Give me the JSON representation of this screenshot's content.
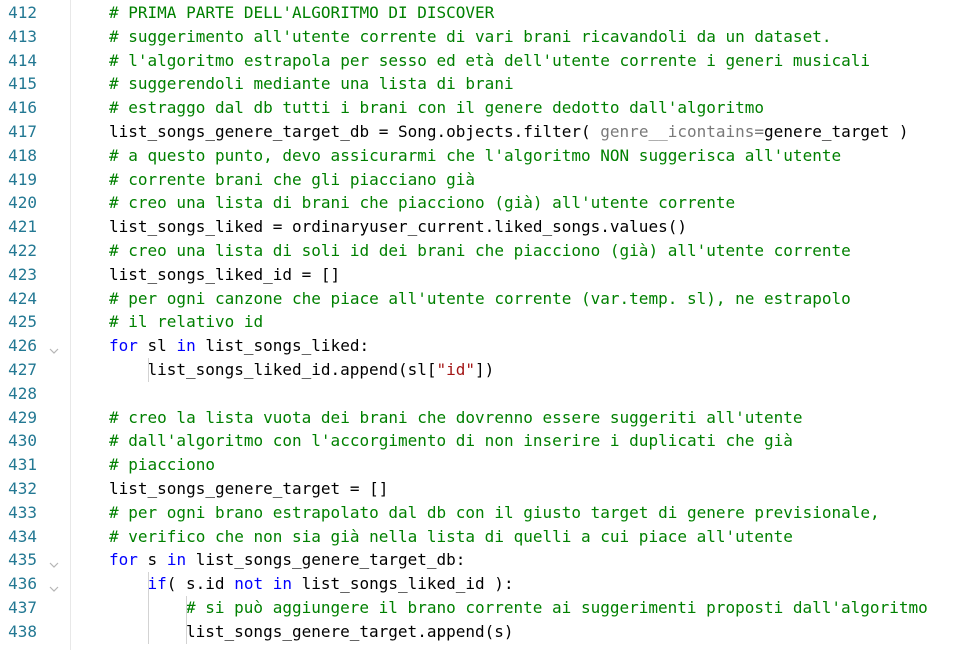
{
  "theme": {
    "comment": "#008000",
    "keyword": "#0000ff",
    "string": "#a31515",
    "line_number": "#237893",
    "hint": "#7a7a7a"
  },
  "icons": {
    "fold": "chevron-down-icon"
  },
  "lines": [
    {
      "n": "412",
      "fold": false,
      "indent": 0,
      "tokens": [
        {
          "t": "# PRIMA PARTE DELL'ALGORITMO DI DISCOVER",
          "k": "comment"
        }
      ]
    },
    {
      "n": "413",
      "fold": false,
      "indent": 0,
      "tokens": [
        {
          "t": "# suggerimento all'utente corrente di vari brani ricavandoli da un dataset.",
          "k": "comment"
        }
      ]
    },
    {
      "n": "414",
      "fold": false,
      "indent": 0,
      "tokens": [
        {
          "t": "# l'algoritmo estrapola per sesso ed età dell'utente corrente i generi musicali",
          "k": "comment"
        }
      ]
    },
    {
      "n": "415",
      "fold": false,
      "indent": 0,
      "tokens": [
        {
          "t": "# suggerendoli mediante una lista di brani",
          "k": "comment"
        }
      ]
    },
    {
      "n": "416",
      "fold": false,
      "indent": 0,
      "tokens": [
        {
          "t": "# estraggo dal db tutti i brani con il genere dedotto dall'algoritmo",
          "k": "comment"
        }
      ]
    },
    {
      "n": "417",
      "fold": false,
      "indent": 0,
      "tokens": [
        {
          "t": "list_songs_genere_target_db = Song.objects.filter( ",
          "k": "plain"
        },
        {
          "t": "genre__icontains=",
          "k": "hint"
        },
        {
          "t": "genere_target )",
          "k": "plain"
        }
      ]
    },
    {
      "n": "418",
      "fold": false,
      "indent": 0,
      "tokens": [
        {
          "t": "# a questo punto, devo assicurarmi che l'algoritmo NON suggerisca all'utente",
          "k": "comment"
        }
      ]
    },
    {
      "n": "419",
      "fold": false,
      "indent": 0,
      "tokens": [
        {
          "t": "# corrente brani che gli piacciano già",
          "k": "comment"
        }
      ]
    },
    {
      "n": "420",
      "fold": false,
      "indent": 0,
      "tokens": [
        {
          "t": "# creo una lista di brani che piacciono (già) all'utente corrente",
          "k": "comment"
        }
      ]
    },
    {
      "n": "421",
      "fold": false,
      "indent": 0,
      "tokens": [
        {
          "t": "list_songs_liked = ordinaryuser_current.liked_songs.values()",
          "k": "plain"
        }
      ]
    },
    {
      "n": "422",
      "fold": false,
      "indent": 0,
      "tokens": [
        {
          "t": "# creo una lista di soli id dei brani che piacciono (già) all'utente corrente",
          "k": "comment"
        }
      ]
    },
    {
      "n": "423",
      "fold": false,
      "indent": 0,
      "tokens": [
        {
          "t": "list_songs_liked_id = []",
          "k": "plain"
        }
      ]
    },
    {
      "n": "424",
      "fold": false,
      "indent": 0,
      "tokens": [
        {
          "t": "# per ogni canzone che piace all'utente corrente (var.temp. sl), ne estrapolo",
          "k": "comment"
        }
      ]
    },
    {
      "n": "425",
      "fold": false,
      "indent": 0,
      "tokens": [
        {
          "t": "# il relativo id",
          "k": "comment"
        }
      ]
    },
    {
      "n": "426",
      "fold": true,
      "indent": 0,
      "tokens": [
        {
          "t": "for",
          "k": "keyword"
        },
        {
          "t": " sl ",
          "k": "plain"
        },
        {
          "t": "in",
          "k": "keyword"
        },
        {
          "t": " list_songs_liked:",
          "k": "plain"
        }
      ]
    },
    {
      "n": "427",
      "fold": false,
      "indent": 1,
      "tokens": [
        {
          "t": "list_songs_liked_id.append(sl[",
          "k": "plain"
        },
        {
          "t": "\"id\"",
          "k": "string"
        },
        {
          "t": "])",
          "k": "plain"
        }
      ]
    },
    {
      "n": "428",
      "fold": false,
      "indent": 0,
      "tokens": []
    },
    {
      "n": "429",
      "fold": false,
      "indent": 0,
      "tokens": [
        {
          "t": "# creo la lista vuota dei brani che dovrenno essere suggeriti all'utente",
          "k": "comment"
        }
      ]
    },
    {
      "n": "430",
      "fold": false,
      "indent": 0,
      "tokens": [
        {
          "t": "# dall'algoritmo con l'accorgimento di non inserire i duplicati che già",
          "k": "comment"
        }
      ]
    },
    {
      "n": "431",
      "fold": false,
      "indent": 0,
      "tokens": [
        {
          "t": "# piacciono",
          "k": "comment"
        }
      ]
    },
    {
      "n": "432",
      "fold": false,
      "indent": 0,
      "tokens": [
        {
          "t": "list_songs_genere_target = []",
          "k": "plain"
        }
      ]
    },
    {
      "n": "433",
      "fold": false,
      "indent": 0,
      "tokens": [
        {
          "t": "# per ogni brano estrapolato dal db con il giusto target di genere previsionale,",
          "k": "comment"
        }
      ]
    },
    {
      "n": "434",
      "fold": false,
      "indent": 0,
      "tokens": [
        {
          "t": "# verifico che non sia già nella lista di quelli a cui piace all'utente",
          "k": "comment"
        }
      ]
    },
    {
      "n": "435",
      "fold": true,
      "indent": 0,
      "tokens": [
        {
          "t": "for",
          "k": "keyword"
        },
        {
          "t": " s ",
          "k": "plain"
        },
        {
          "t": "in",
          "k": "keyword"
        },
        {
          "t": " list_songs_genere_target_db:",
          "k": "plain"
        }
      ]
    },
    {
      "n": "436",
      "fold": true,
      "indent": 1,
      "tokens": [
        {
          "t": "if",
          "k": "keyword"
        },
        {
          "t": "( s.id ",
          "k": "plain"
        },
        {
          "t": "not",
          "k": "keyword"
        },
        {
          "t": " ",
          "k": "plain"
        },
        {
          "t": "in",
          "k": "keyword"
        },
        {
          "t": " list_songs_liked_id ):",
          "k": "plain"
        }
      ]
    },
    {
      "n": "437",
      "fold": false,
      "indent": 2,
      "tokens": [
        {
          "t": "# si può aggiungere il brano corrente ai suggerimenti proposti dall'algoritmo",
          "k": "comment"
        }
      ]
    },
    {
      "n": "438",
      "fold": false,
      "indent": 2,
      "tokens": [
        {
          "t": "list_songs_genere_target.append(s)",
          "k": "plain"
        }
      ]
    }
  ]
}
